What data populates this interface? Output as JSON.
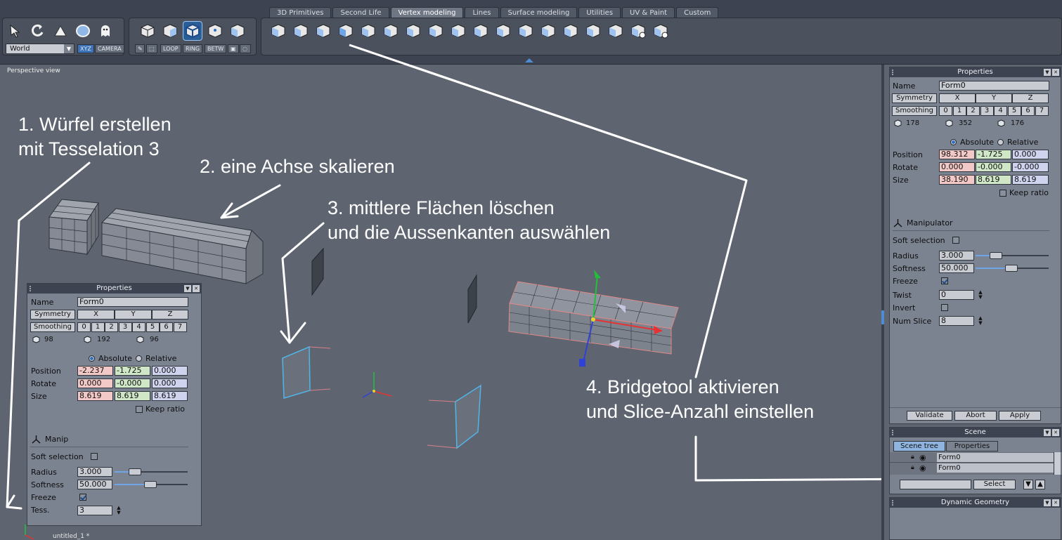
{
  "tabs": [
    "3D Primitives",
    "Second Life",
    "Vertex modeling",
    "Lines",
    "Surface modeling",
    "Utilities",
    "UV & Paint",
    "Custom"
  ],
  "active_tab": "Vertex modeling",
  "toolbar": {
    "coord_system": "World",
    "xyz_label": "XYZ",
    "camera_label": "CAMERA",
    "loop_label": "LOOP",
    "ring_label": "RING",
    "betw_label": "BETW"
  },
  "viewport": {
    "label": "Perspective view",
    "footer": "untitled_1 *"
  },
  "annotations": {
    "step1_line1": "1. Würfel erstellen",
    "step1_line2": "mit Tesselation 3",
    "step2": "2. eine Achse skalieren",
    "step3_line1": "3. mittlere Flächen löschen",
    "step3_line2": "und die Aussenkanten auswählen",
    "step4_line1": "4. Bridgetool aktivieren",
    "step4_line2": "und Slice-Anzahl einstellen"
  },
  "props_left": {
    "title": "Properties",
    "name_label": "Name",
    "name_value": "Form0",
    "symmetry_label": "Symmetry",
    "axes": [
      "X",
      "Y",
      "Z"
    ],
    "smoothing_label": "Smoothing",
    "smoothing_levels": [
      "0",
      "1",
      "2",
      "3",
      "4",
      "5",
      "6",
      "7"
    ],
    "counts": [
      "98",
      "192",
      "96"
    ],
    "absolute_label": "Absolute",
    "relative_label": "Relative",
    "position_label": "Position",
    "position": [
      "-2.237",
      "-1.725",
      "0.000"
    ],
    "rotate_label": "Rotate",
    "rotate": [
      "0.000",
      "-0.000",
      "0.000"
    ],
    "size_label": "Size",
    "size": [
      "8.619",
      "8.619",
      "8.619"
    ],
    "keep_ratio_label": "Keep ratio",
    "manip_label": "Manip",
    "soft_selection_label": "Soft selection",
    "radius_label": "Radius",
    "radius_value": "3.000",
    "softness_label": "Softness",
    "softness_value": "50.000",
    "freeze_label": "Freeze",
    "tess_label": "Tess.",
    "tess_value": "3"
  },
  "props_right": {
    "title": "Properties",
    "name_label": "Name",
    "name_value": "Form0",
    "symmetry_label": "Symmetry",
    "axes": [
      "X",
      "Y",
      "Z"
    ],
    "smoothing_label": "Smoothing",
    "smoothing_levels": [
      "0",
      "1",
      "2",
      "3",
      "4",
      "5",
      "6",
      "7"
    ],
    "counts": [
      "178",
      "352",
      "176"
    ],
    "absolute_label": "Absolute",
    "relative_label": "Relative",
    "position_label": "Position",
    "position": [
      "98.312",
      "-1.725",
      "0.000"
    ],
    "rotate_label": "Rotate",
    "rotate": [
      "0.000",
      "-0.000",
      "-0.000"
    ],
    "size_label": "Size",
    "size": [
      "38.190",
      "8.619",
      "8.619"
    ],
    "keep_ratio_label": "Keep ratio",
    "manip_label": "Manipulator",
    "soft_selection_label": "Soft selection",
    "radius_label": "Radius",
    "radius_value": "3.000",
    "softness_label": "Softness",
    "softness_value": "50.000",
    "freeze_label": "Freeze",
    "twist_label": "Twist",
    "twist_value": "0",
    "invert_label": "Invert",
    "num_slice_label": "Num Slice",
    "num_slice_value": "8",
    "validate_label": "Validate",
    "abort_label": "Abort",
    "apply_label": "Apply"
  },
  "scene": {
    "title": "Scene",
    "tabs": [
      "Scene tree",
      "Properties"
    ],
    "items": [
      "Form0",
      "Form0"
    ],
    "select_label": "Select"
  },
  "dynamic_geometry": {
    "title": "Dynamic Geometry"
  },
  "colors": {
    "annotation": "#ffffff",
    "viewport_bg": "#5f6570",
    "panel_bg": "#7c8390",
    "accent_blue": "#2b5d96"
  }
}
